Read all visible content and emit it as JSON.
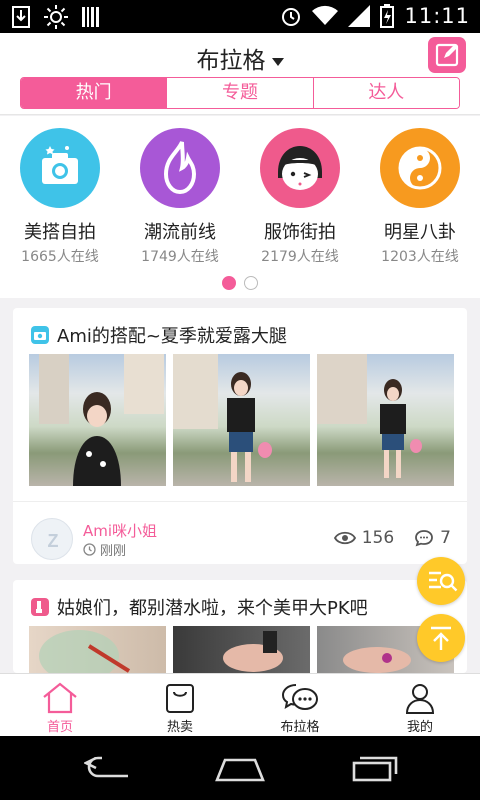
{
  "status_bar": {
    "time": "11:11"
  },
  "header": {
    "title": "布拉格",
    "tabs": [
      {
        "label": "热门",
        "active": true
      },
      {
        "label": "专题",
        "active": false
      },
      {
        "label": "达人",
        "active": false
      }
    ]
  },
  "categories": [
    {
      "name": "美搭自拍",
      "online": "1665人在线",
      "color": "#3fc3e8",
      "icon": "camera-icon"
    },
    {
      "name": "潮流前线",
      "online": "1749人在线",
      "color": "#a857d6",
      "icon": "flame-icon"
    },
    {
      "name": "服饰街拍",
      "online": "2179人在线",
      "color": "#ef5a8c",
      "icon": "girl-face-icon"
    },
    {
      "name": "明星八卦",
      "online": "1203人在线",
      "color": "#f79a1f",
      "icon": "yin-yang-icon"
    }
  ],
  "pager": {
    "current": 1,
    "total": 2
  },
  "posts": [
    {
      "title": "Ami的搭配~夏季就爱露大腿",
      "author": "Ami咪小姐",
      "time": "刚刚",
      "views": "156",
      "comments": "7"
    },
    {
      "title": "姑娘们，都别潜水啦，来个美甲大PK吧"
    }
  ],
  "tabbar": [
    {
      "label": "首页",
      "icon": "home-icon",
      "active": true
    },
    {
      "label": "热卖",
      "icon": "shopping-bag-icon",
      "active": false
    },
    {
      "label": "布拉格",
      "icon": "chat-bubble-icon",
      "active": false
    },
    {
      "label": "我的",
      "icon": "person-icon",
      "active": false
    }
  ],
  "colors": {
    "accent": "#f45c99",
    "fab": "#ffc929"
  }
}
